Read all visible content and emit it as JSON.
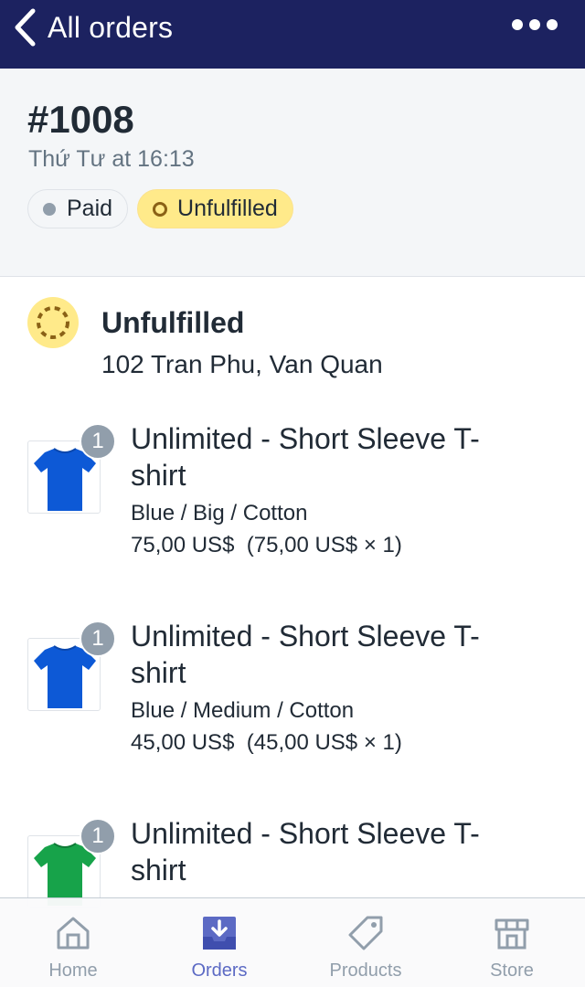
{
  "nav": {
    "back_label": "All orders",
    "more_icon": "more-horizontal-icon"
  },
  "order": {
    "number": "#1008",
    "date": "Thứ Tư at 16:13",
    "badges": {
      "paid": "Paid",
      "unfulfilled": "Unfulfilled"
    }
  },
  "fulfillment": {
    "status": "Unfulfilled",
    "address": "102 Tran Phu, Van Quan",
    "icon": "unfulfilled-dashed-circle-icon"
  },
  "line_items": [
    {
      "title": "Unlimited - Short Sleeve T-shirt",
      "variant": "Blue / Big / Cotton",
      "price": "75,00 US$  (75,00 US$ × 1)",
      "quantity": "1",
      "color": "#0d59d6"
    },
    {
      "title": "Unlimited - Short Sleeve T-shirt",
      "variant": "Blue / Medium / Cotton",
      "price": "45,00 US$  (45,00 US$ × 1)",
      "quantity": "1",
      "color": "#0d59d6"
    },
    {
      "title": "Unlimited - Short Sleeve T-shirt",
      "quantity": "1",
      "color": "#17a34a"
    }
  ],
  "tabbar": {
    "items": [
      {
        "label": "Home",
        "icon": "home-icon",
        "active": false
      },
      {
        "label": "Orders",
        "icon": "orders-inbox-icon",
        "active": true
      },
      {
        "label": "Products",
        "icon": "tag-icon",
        "active": false
      },
      {
        "label": "Store",
        "icon": "storefront-icon",
        "active": false
      }
    ]
  },
  "colors": {
    "nav_bg": "#1c2260",
    "accent": "#5c6ac4",
    "unfulfilled_badge": "#ffea8a",
    "muted": "#919eab"
  }
}
